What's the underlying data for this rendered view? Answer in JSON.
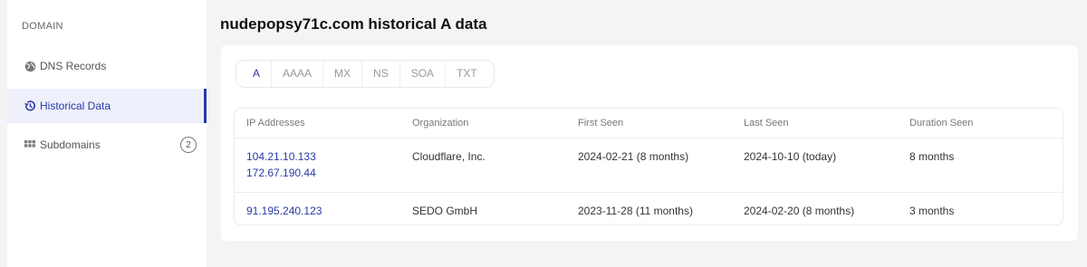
{
  "sidebar": {
    "heading": "DOMAIN",
    "items": [
      {
        "label": "DNS Records",
        "icon": "globe-icon"
      },
      {
        "label": "Historical Data",
        "icon": "history-icon",
        "active": true
      },
      {
        "label": "Subdomains",
        "icon": "grid-icon",
        "badge": "2"
      }
    ]
  },
  "page": {
    "title": "nudepopsy71c.com historical A data"
  },
  "tabs": [
    "A",
    "AAAA",
    "MX",
    "NS",
    "SOA",
    "TXT"
  ],
  "table": {
    "headers": [
      "IP Addresses",
      "Organization",
      "First Seen",
      "Last Seen",
      "Duration Seen"
    ],
    "rows": [
      {
        "ips": [
          "104.21.10.133",
          "172.67.190.44"
        ],
        "organization": "Cloudflare, Inc.",
        "first_seen": "2024-02-21 (8 months)",
        "last_seen": "2024-10-10 (today)",
        "duration": "8 months"
      },
      {
        "ips": [
          "91.195.240.123"
        ],
        "organization": "SEDO GmbH",
        "first_seen": "2023-11-28 (11 months)",
        "last_seen": "2024-02-20 (8 months)",
        "duration": "3 months"
      }
    ]
  },
  "colors": {
    "accent": "#2a3aa8",
    "background": "#f4f4f5"
  }
}
